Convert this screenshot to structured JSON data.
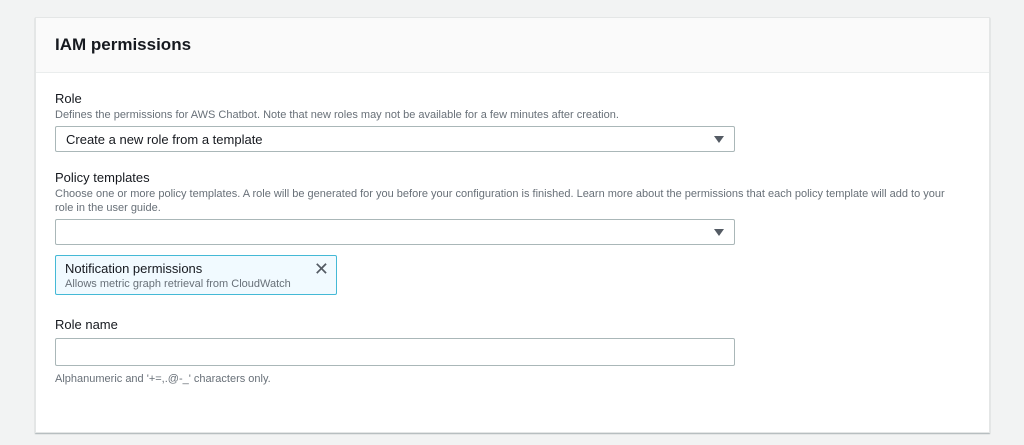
{
  "title": "IAM permissions",
  "role": {
    "label": "Role",
    "description": "Defines the permissions for AWS Chatbot. Note that new roles may not be available for a few minutes after creation.",
    "value": "Create a new role from a template"
  },
  "policy": {
    "label": "Policy templates",
    "description": "Choose one or more policy templates. A role will be generated for you before your configuration is finished. Learn more about the permissions that each policy template will add to your role in the user guide.",
    "value": "",
    "token": {
      "title": "Notification permissions",
      "subtitle": "Allows metric graph retrieval from CloudWatch",
      "remove": "✕"
    }
  },
  "role_name": {
    "label": "Role name",
    "value": "",
    "hint": "Alphanumeric and '+=,.@-_' characters only."
  }
}
